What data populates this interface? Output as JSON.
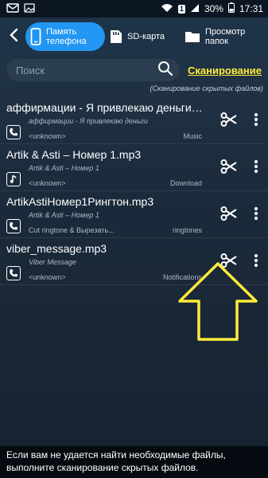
{
  "status_bar": {
    "notification_badge": "1",
    "battery": "30%",
    "time": "17:31"
  },
  "toolbar": {
    "tabs": [
      {
        "label": "Память телефона",
        "active": true,
        "icon": "phone-icon"
      },
      {
        "label": "SD-карта",
        "active": false,
        "icon": "sd-card-icon"
      },
      {
        "label": "Просмотр папок",
        "active": false,
        "icon": "folder-icon"
      }
    ]
  },
  "search": {
    "placeholder": "Поиск",
    "scan_label": "Сканирование",
    "scan_hint": "(Сканирование скрытых файлов)"
  },
  "files": [
    {
      "title": "аффирмации - Я привлекаю деньги.mp3",
      "artist": "аффирмации - Я привлекаю деньги",
      "album": "<unknown>",
      "folder": "Music",
      "type_icon": "phone-icon"
    },
    {
      "title": "Artik & Asti – Номер 1.mp3",
      "artist": "Artik & Asti – Номер 1",
      "album": "<unknown>",
      "folder": "Download",
      "type_icon": "music-note-icon"
    },
    {
      "title": "ArtikAstiНомер1Рингтон.mp3",
      "artist": "Artik & Asti – Номер 1",
      "album": "Cut ringtone & Вырезать...",
      "folder": "ringtones",
      "type_icon": "phone-icon"
    },
    {
      "title": "viber_message.mp3",
      "artist": "Viber Message",
      "album": "<unknown>",
      "folder": "Notifications",
      "type_icon": "phone-icon"
    }
  ],
  "footer": {
    "text": "Если вам не удается найти необходимые файлы, выполните сканирование скрытых файлов."
  },
  "colors": {
    "accent": "#2196f3",
    "scan_link": "#ffeb3b",
    "arrow": "#ffeb3b",
    "background": "#1b2a3a"
  }
}
